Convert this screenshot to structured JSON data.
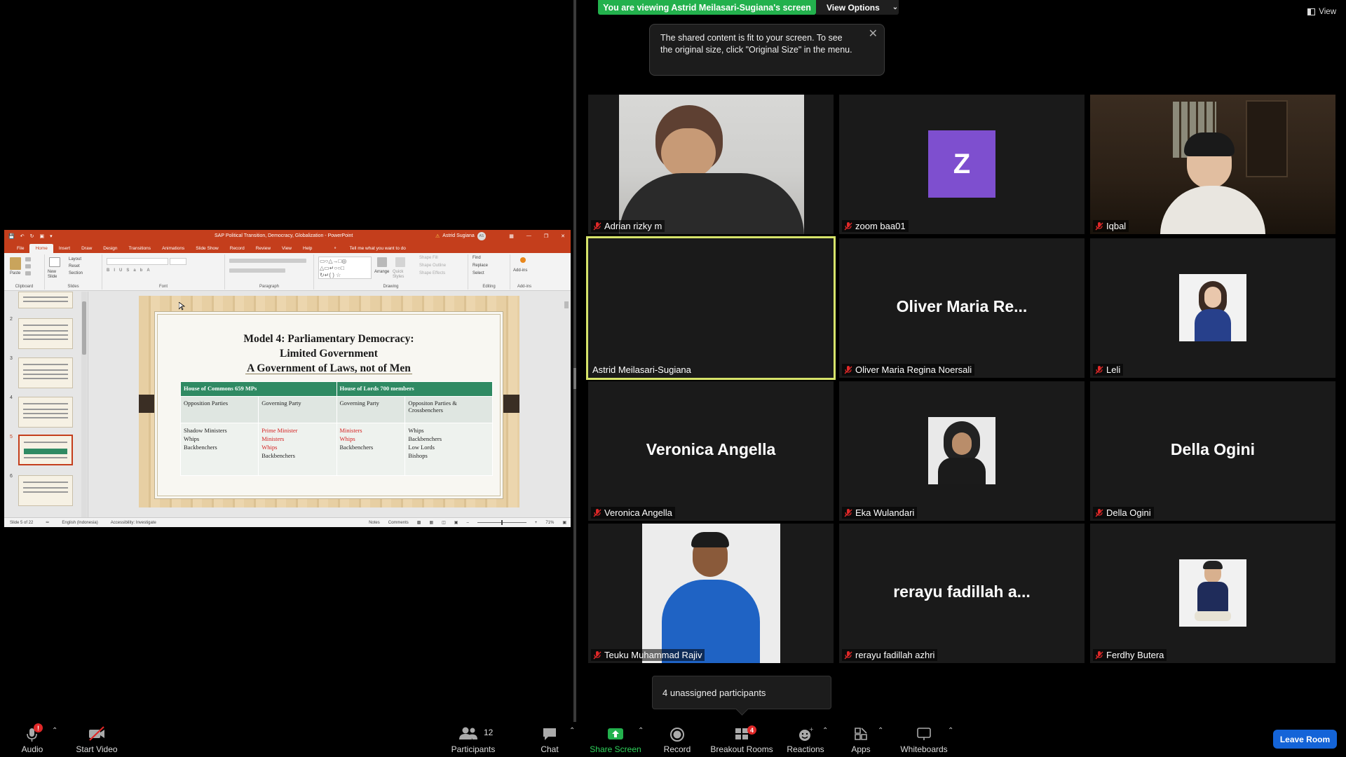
{
  "meeting": {
    "viewing_banner": "You are viewing Astrid Meilasari-Sugiana's screen",
    "view_options": "View Options",
    "view_button": "View",
    "tooltip": "The shared content is fit to your screen. To see the original size, click \"Original Size\" in the menu.",
    "unassigned": "4 unassigned participants",
    "leave": "Leave Room"
  },
  "ppt": {
    "doc_title": "SAP Political Transition, Democracy, Globalization  -  PowerPoint",
    "user": "Astrid Sugiana",
    "user_initials": "AS",
    "tabs": [
      "File",
      "Home",
      "Insert",
      "Draw",
      "Design",
      "Transitions",
      "Animations",
      "Slide Show",
      "Record",
      "Review",
      "View",
      "Help"
    ],
    "tell_me": "Tell me what you want to do",
    "ribbon_groups": {
      "clipboard": "Clipboard",
      "paste": "Paste",
      "new_slide": "New Slide",
      "layout": "Layout",
      "reset": "Reset",
      "section": "Section",
      "slides": "Slides",
      "font": "Font",
      "paragraph": "Paragraph",
      "arrange": "Arrange",
      "quick_styles": "Quick Styles",
      "shape_fill": "Shape Fill",
      "shape_outline": "Shape Outline",
      "shape_effects": "Shape Effects",
      "drawing": "Drawing",
      "find": "Find",
      "replace": "Replace",
      "select": "Select",
      "editing": "Editing",
      "addins": "Add-ins",
      "addins_group": "Add-ins"
    },
    "thumb_numbers": [
      "2",
      "3",
      "4",
      "5",
      "6"
    ],
    "slide": {
      "title_line1": "Model 4: Parliamentary Democracy:",
      "title_line2": "Limited Government",
      "title_line3": "A Government of Laws, not of Men",
      "header_commons": "House of Commons 659 MPs",
      "header_lords": "House of Lords 700 members",
      "row1": [
        "Opposition Parties",
        "Governing Party",
        "Governing Party",
        "Oppositon Parties & Crossbenchers"
      ],
      "col1": [
        "Shadow Ministers",
        "Whips",
        "Backbenchers"
      ],
      "col2_red": [
        "Prime Minister",
        "Ministers",
        "Whips"
      ],
      "col2_black": "Backbenchers",
      "col3_red": [
        "Ministers",
        "Whips"
      ],
      "col3_black": "Backbenchers",
      "col4": [
        "Whips",
        "Backbenchers",
        "Low Lords",
        "Bishops"
      ]
    },
    "status": {
      "slide": "Slide 5 of 22",
      "language": "English (Indonesia)",
      "accessibility": "Accessibility: Investigate",
      "notes": "Notes",
      "comments": "Comments",
      "zoom": "71%"
    }
  },
  "participants": [
    {
      "name": "Adrian rizky m",
      "type": "video"
    },
    {
      "name": "zoom baa01",
      "type": "avatar-letter",
      "letter": "Z"
    },
    {
      "name": "Iqbal",
      "type": "video"
    },
    {
      "name": "Astrid Meilasari-Sugiana",
      "type": "blank"
    },
    {
      "name": "Oliver Maria Regina Noersali",
      "type": "name",
      "display": "Oliver Maria Re..."
    },
    {
      "name": "Leli",
      "type": "avatar"
    },
    {
      "name": "Veronica Angella",
      "type": "name",
      "display": "Veronica Angella"
    },
    {
      "name": "Eka Wulandari",
      "type": "avatar"
    },
    {
      "name": "Della Ogini",
      "type": "name",
      "display": "Della Ogini"
    },
    {
      "name": "Teuku Muhammad Rajiv",
      "type": "video"
    },
    {
      "name": "rerayu fadillah azhri",
      "type": "name",
      "display": "rerayu fadillah a..."
    },
    {
      "name": "Ferdhy Butera",
      "type": "avatar"
    }
  ],
  "toolbar": {
    "audio": "Audio",
    "audio_badge": "!",
    "start_video": "Start Video",
    "participants": "Participants",
    "participants_count": "12",
    "chat": "Chat",
    "share_screen": "Share Screen",
    "record": "Record",
    "breakout_rooms": "Breakout Rooms",
    "breakout_badge": "4",
    "reactions": "Reactions",
    "apps": "Apps",
    "whiteboards": "Whiteboards"
  },
  "colors": {
    "banner_green": "#23b14d",
    "ppt_red": "#c43e1c",
    "speaker_border": "#d6e36a",
    "leave_blue": "#1464d8",
    "table_header": "#2f8a63"
  }
}
